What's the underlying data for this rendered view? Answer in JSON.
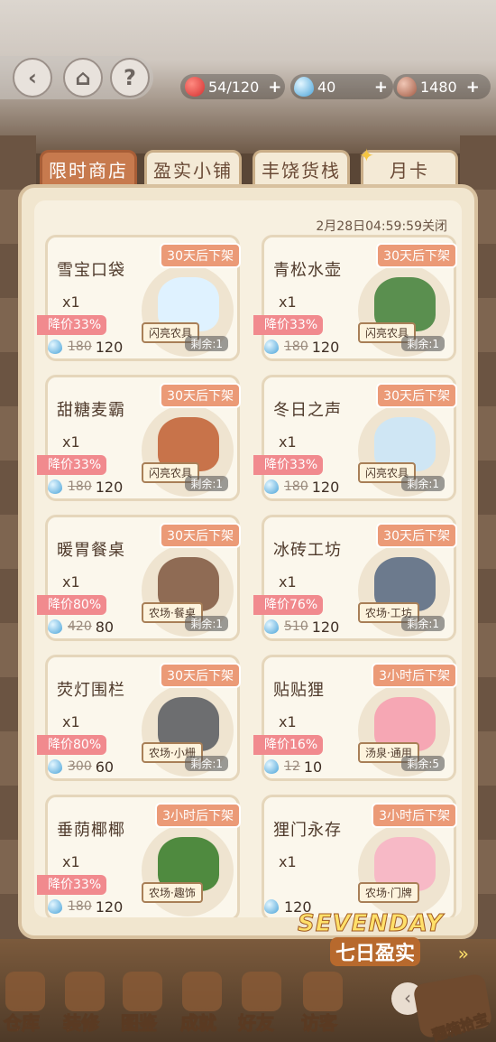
{
  "resources": {
    "apple": "54/120",
    "water": "40",
    "seed": "1480"
  },
  "tabs": [
    "限时商店",
    "盈实小铺",
    "丰饶货栈",
    "月卡"
  ],
  "deadline": "2月28日04:59:59关闭",
  "items": [
    {
      "name": "雪宝口袋",
      "qty": "x1",
      "badge": "30天后下架",
      "discount": "降价33%",
      "old": "180",
      "price": "120",
      "tag": "闪亮农具",
      "stock": "剩余:1"
    },
    {
      "name": "青松水壶",
      "qty": "x1",
      "badge": "30天后下架",
      "discount": "降价33%",
      "old": "180",
      "price": "120",
      "tag": "闪亮农具",
      "stock": "剩余:1"
    },
    {
      "name": "甜糖麦霸",
      "qty": "x1",
      "badge": "30天后下架",
      "discount": "降价33%",
      "old": "180",
      "price": "120",
      "tag": "闪亮农具",
      "stock": "剩余:1"
    },
    {
      "name": "冬日之声",
      "qty": "x1",
      "badge": "30天后下架",
      "discount": "降价33%",
      "old": "180",
      "price": "120",
      "tag": "闪亮农具",
      "stock": "剩余:1"
    },
    {
      "name": "暖胃餐桌",
      "qty": "x1",
      "badge": "30天后下架",
      "discount": "降价80%",
      "old": "420",
      "price": "80",
      "tag": "农场·餐桌",
      "stock": "剩余:1"
    },
    {
      "name": "冰砖工坊",
      "qty": "x1",
      "badge": "30天后下架",
      "discount": "降价76%",
      "old": "510",
      "price": "120",
      "tag": "农场·工坊",
      "stock": "剩余:1"
    },
    {
      "name": "荧灯围栏",
      "qty": "x1",
      "badge": "30天后下架",
      "discount": "降价80%",
      "old": "300",
      "price": "60",
      "tag": "农场·小栅",
      "stock": "剩余:1"
    },
    {
      "name": "贴贴狸",
      "qty": "x1",
      "badge": "3小时后下架",
      "discount": "降价16%",
      "old": "12",
      "price": "10",
      "tag": "汤泉·通用",
      "stock": "剩余:5"
    },
    {
      "name": "垂荫椰椰",
      "qty": "x1",
      "badge": "3小时后下架",
      "discount": "降价33%",
      "old": "180",
      "price": "120",
      "tag": "农场·趣饰",
      "stock": ""
    },
    {
      "name": "狸门永存",
      "qty": "x1",
      "badge": "3小时后下架",
      "discount": "",
      "old": "",
      "price": "120",
      "tag": "农场·门牌",
      "stock": ""
    }
  ],
  "logo": {
    "en": "SEVENDAY",
    "cn": "七日盈实"
  },
  "menu": [
    "仓库",
    "装修",
    "图鉴",
    "成就",
    "好友",
    "访客"
  ],
  "chest_label": "翻箱拾宝",
  "colors": {
    "accent": "#c77a4e",
    "badge": "#eb9a77",
    "discount": "#f18a8e",
    "panel": "#f1e6cf"
  }
}
